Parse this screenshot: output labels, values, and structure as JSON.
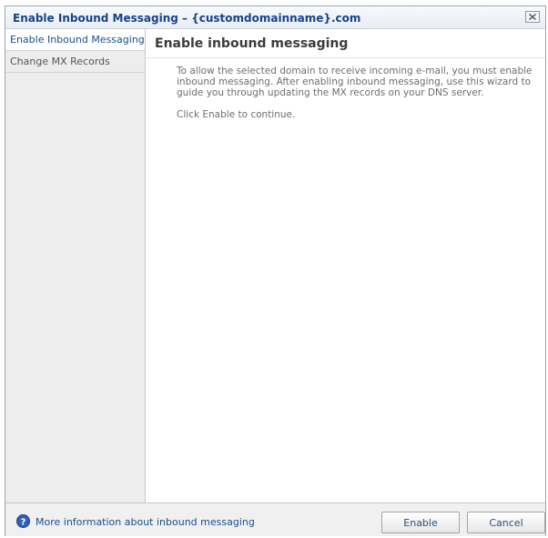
{
  "window": {
    "title": "Enable Inbound Messaging – {customdomainname}.com"
  },
  "sidebar": {
    "items": [
      {
        "label": "Enable Inbound Messaging",
        "active": true
      },
      {
        "label": "Change MX Records",
        "active": false
      }
    ]
  },
  "main": {
    "heading": "Enable inbound messaging",
    "paragraphs": [
      "To allow the selected domain to receive incoming e-mail, you must enable inbound messaging. After enabling inbound messaging, use this wizard to guide you through updating the MX records on your DNS server.",
      "Click Enable to continue."
    ]
  },
  "footer": {
    "help_link": "More information about inbound messaging",
    "enable_label": "Enable",
    "cancel_label": "Cancel"
  },
  "colors": {
    "title": "#15428b",
    "link": "#1b4f8d",
    "help_icon": "#2f5fb3"
  },
  "icons": {
    "close": "close-icon",
    "help": "help-icon"
  }
}
